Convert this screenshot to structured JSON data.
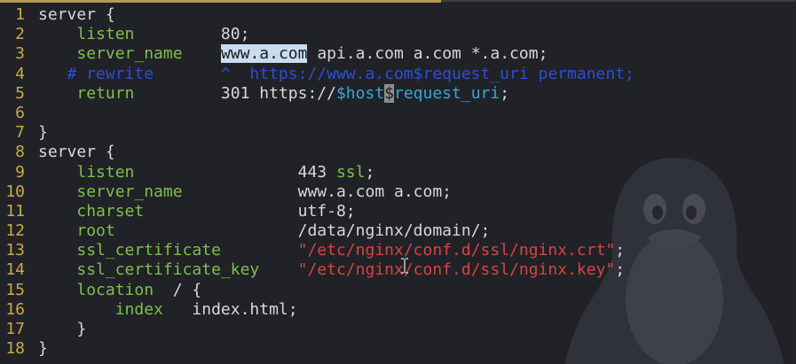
{
  "editor": {
    "colors": {
      "background": "#202227",
      "line_number": "#c9a94a",
      "directive": "#7ec04a",
      "string": "#d9443c",
      "variable": "#36a7d6",
      "comment": "#2b4fd6",
      "selection": "#c9dcf0"
    },
    "lines": [
      {
        "n": "1",
        "segments": [
          {
            "t": "server {",
            "c": "kw"
          }
        ]
      },
      {
        "n": "2",
        "segments": [
          {
            "t": "    ",
            "c": "val"
          },
          {
            "t": "listen",
            "c": "dir"
          },
          {
            "t": "         80;",
            "c": "val"
          }
        ]
      },
      {
        "n": "3",
        "segments": [
          {
            "t": "    ",
            "c": "val"
          },
          {
            "t": "server_name",
            "c": "dir"
          },
          {
            "t": "    ",
            "c": "val"
          },
          {
            "t": "www.a.com",
            "c": "sel"
          },
          {
            "t": " api.a.com a.com *.a.com;",
            "c": "val"
          }
        ]
      },
      {
        "n": "4",
        "segments": [
          {
            "t": "   # rewrite       ^  https://www.a.com$request_uri permanent;",
            "c": "cmt"
          }
        ]
      },
      {
        "n": "5",
        "segments": [
          {
            "t": "    ",
            "c": "val"
          },
          {
            "t": "return",
            "c": "dir"
          },
          {
            "t": "         301 https://",
            "c": "val"
          },
          {
            "t": "$host",
            "c": "var"
          },
          {
            "t": "$",
            "c": "cur"
          },
          {
            "t": "request_uri",
            "c": "var"
          },
          {
            "t": ";",
            "c": "val"
          }
        ]
      },
      {
        "n": "6",
        "segments": []
      },
      {
        "n": "7",
        "segments": [
          {
            "t": "}",
            "c": "kw"
          }
        ]
      },
      {
        "n": "8",
        "segments": [
          {
            "t": "server {",
            "c": "kw"
          }
        ]
      },
      {
        "n": "9",
        "segments": [
          {
            "t": "    ",
            "c": "val"
          },
          {
            "t": "listen",
            "c": "dir"
          },
          {
            "t": "                 443 ",
            "c": "val"
          },
          {
            "t": "ssl",
            "c": "dir"
          },
          {
            "t": ";",
            "c": "val"
          }
        ]
      },
      {
        "n": "10",
        "segments": [
          {
            "t": "    ",
            "c": "val"
          },
          {
            "t": "server_name",
            "c": "dir"
          },
          {
            "t": "            www.a.com a.com;",
            "c": "val"
          }
        ]
      },
      {
        "n": "11",
        "segments": [
          {
            "t": "    ",
            "c": "val"
          },
          {
            "t": "charset",
            "c": "dir"
          },
          {
            "t": "                utf-8;",
            "c": "val"
          }
        ]
      },
      {
        "n": "12",
        "segments": [
          {
            "t": "    ",
            "c": "val"
          },
          {
            "t": "root",
            "c": "dir"
          },
          {
            "t": "                   /data/nginx/domain/;",
            "c": "val"
          }
        ]
      },
      {
        "n": "13",
        "segments": [
          {
            "t": "    ",
            "c": "val"
          },
          {
            "t": "ssl_certificate",
            "c": "dir"
          },
          {
            "t": "        ",
            "c": "val"
          },
          {
            "t": "\"/etc/nginx/conf.d/ssl/nginx.crt\"",
            "c": "str"
          },
          {
            "t": ";",
            "c": "val"
          }
        ]
      },
      {
        "n": "14",
        "segments": [
          {
            "t": "    ",
            "c": "val"
          },
          {
            "t": "ssl_certificate_key",
            "c": "dir"
          },
          {
            "t": "    ",
            "c": "val"
          },
          {
            "t": "\"/etc/nginx/conf.d/ssl/nginx.key\"",
            "c": "str"
          },
          {
            "t": ";",
            "c": "val"
          }
        ]
      },
      {
        "n": "15",
        "segments": [
          {
            "t": "    ",
            "c": "val"
          },
          {
            "t": "location",
            "c": "dir"
          },
          {
            "t": "  / {",
            "c": "val"
          }
        ]
      },
      {
        "n": "16",
        "segments": [
          {
            "t": "        ",
            "c": "val"
          },
          {
            "t": "index",
            "c": "dir"
          },
          {
            "t": "   index.html;",
            "c": "val"
          }
        ]
      },
      {
        "n": "17",
        "segments": [
          {
            "t": "    }",
            "c": "val"
          }
        ]
      },
      {
        "n": "18",
        "segments": [
          {
            "t": "}",
            "c": "kw"
          }
        ]
      }
    ]
  }
}
